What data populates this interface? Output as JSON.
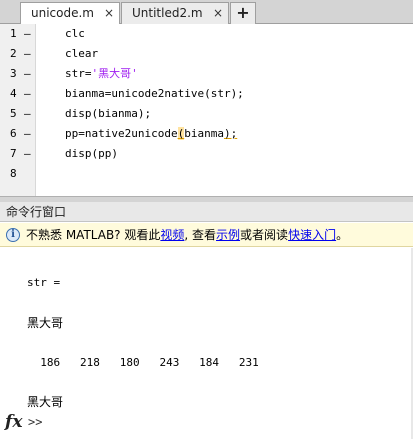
{
  "editor": {
    "tabs": [
      {
        "label": "unicode.m",
        "close": "×",
        "active": true
      },
      {
        "label": "Untitled2.m",
        "close": "×",
        "active": false
      }
    ],
    "new_tab": "+",
    "lines": [
      {
        "num": "1",
        "dash": "–",
        "text": "clc"
      },
      {
        "num": "2",
        "dash": "–",
        "text": "clear"
      },
      {
        "num": "3",
        "dash": "–",
        "pre": "str=",
        "string": "'黑大哥'"
      },
      {
        "num": "4",
        "dash": "–",
        "text": "bianma=unicode2native(str);"
      },
      {
        "num": "5",
        "dash": "–",
        "text": "disp(bianma);"
      },
      {
        "num": "6",
        "dash": "–",
        "pre": "pp=native2unicode",
        "paren": "(",
        "mid": "bianma",
        "tail": ");"
      },
      {
        "num": "7",
        "dash": "–",
        "text": "disp(pp)"
      },
      {
        "num": "8",
        "dash": "",
        "text": ""
      }
    ]
  },
  "command_window": {
    "title": "命令行窗口",
    "info": {
      "icon": "info-icon",
      "text1": "不熟悉 MATLAB? 观看此",
      "link1": "视频",
      "text2": ", 查看",
      "link2": "示例",
      "text3": "或者阅读",
      "link3": "快速入门",
      "text4": "。"
    },
    "output": {
      "line1": "str =",
      "line2": "黑大哥",
      "line3": "  186   218   180   243   184   231",
      "line4": "黑大哥"
    },
    "fx": "fx",
    "prompt": ">>"
  }
}
